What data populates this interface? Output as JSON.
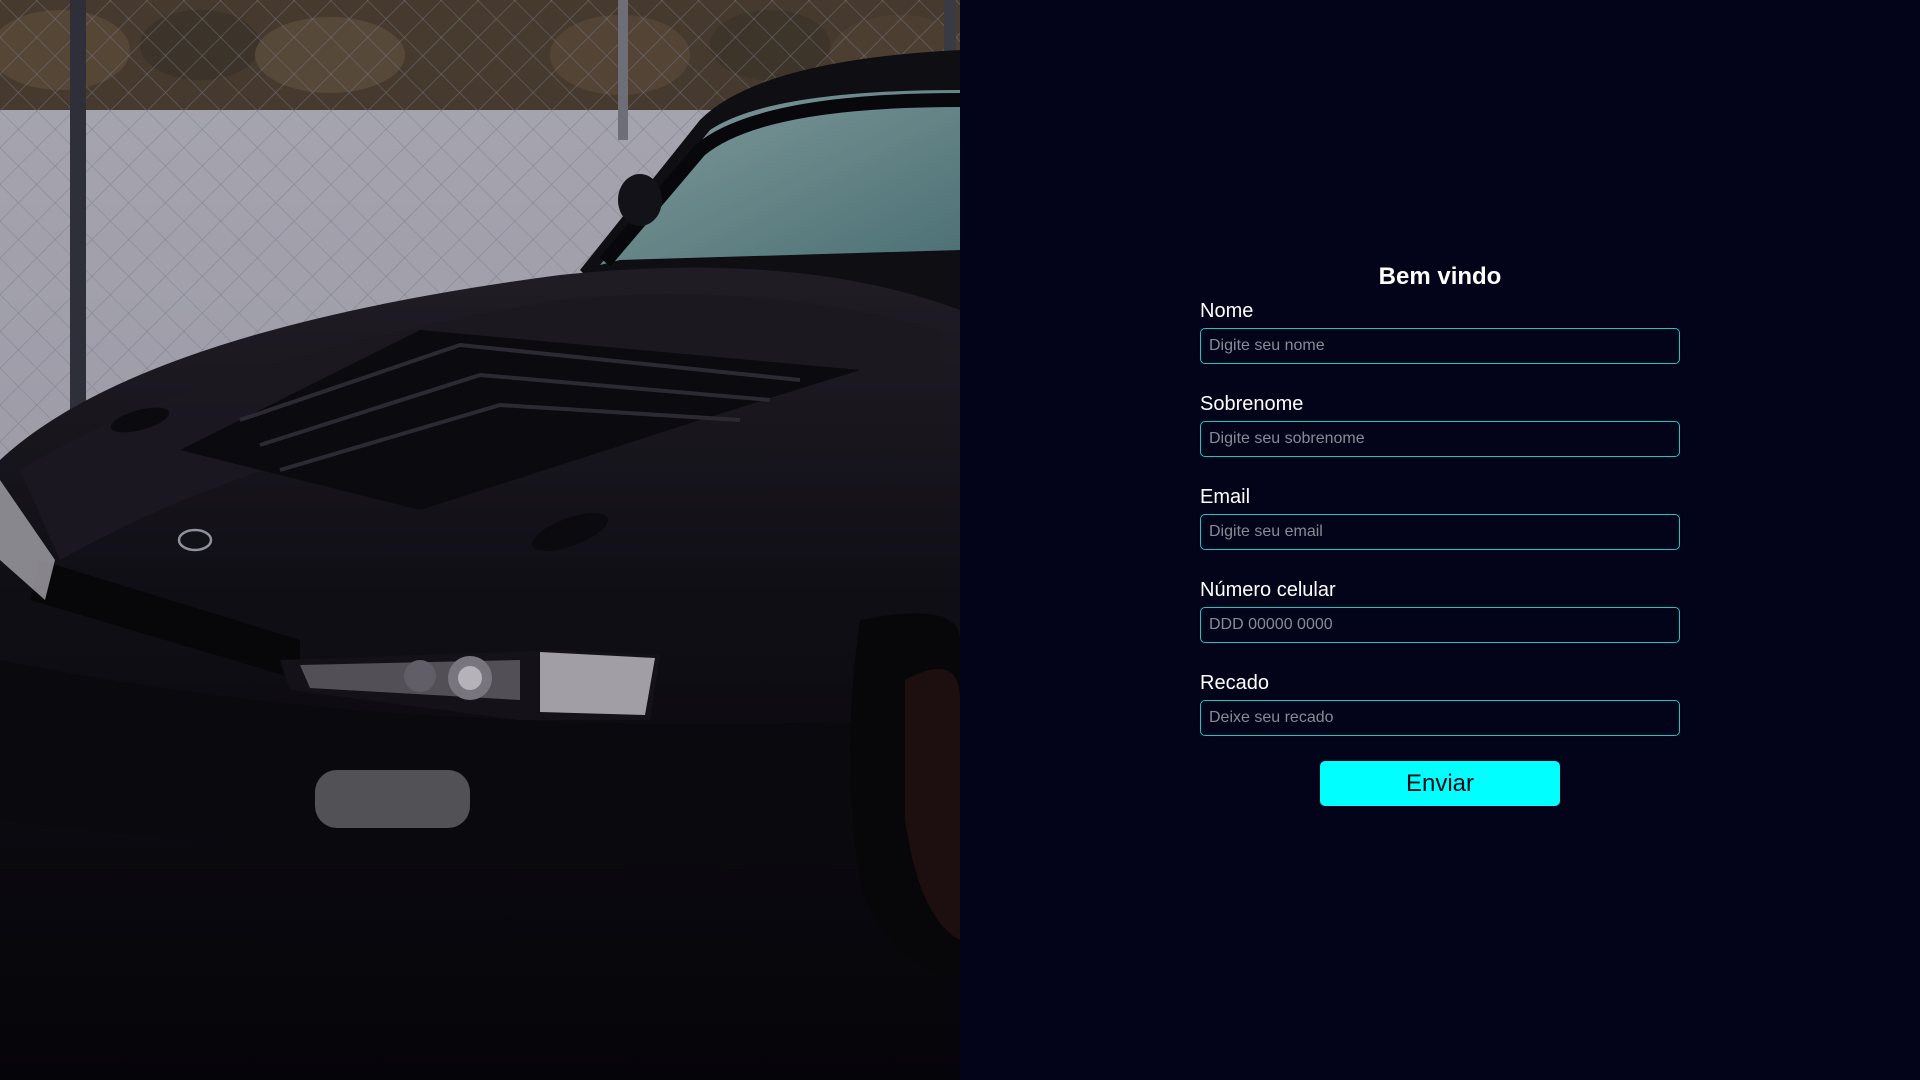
{
  "form": {
    "title": "Bem vindo",
    "fields": [
      {
        "label": "Nome",
        "placeholder": "Digite seu nome"
      },
      {
        "label": "Sobrenome",
        "placeholder": "Digite seu sobrenome"
      },
      {
        "label": "Email",
        "placeholder": "Digite seu email"
      },
      {
        "label": "Número celular",
        "placeholder": "DDD 00000 0000"
      },
      {
        "label": "Recado",
        "placeholder": "Deixe seu recado"
      }
    ],
    "submit_label": "Enviar"
  },
  "colors": {
    "background": "#03031a",
    "accent": "#00ffff",
    "input_border": "#19c6c6"
  }
}
